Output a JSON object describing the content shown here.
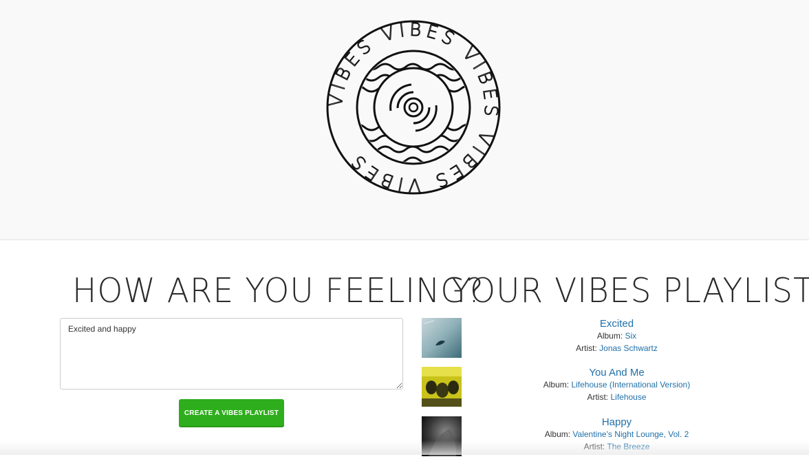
{
  "logo": {
    "ring_text": "VIBES VIBES VIBES VIBES VIBES",
    "icon": "vinyl-record-waves-icon"
  },
  "feeling": {
    "heading": "HOW ARE YOU FEELING?",
    "input_value": "Excited and happy",
    "button_label": "CREATE A VIBES PLAYLIST",
    "button_color": "#2eae1c"
  },
  "playlist": {
    "heading": "YOUR VIBES PLAYLIST",
    "album_label": "Album:",
    "artist_label": "Artist:",
    "link_color": "#1f6fa8",
    "tracks": [
      {
        "title": "Excited",
        "album": "Six",
        "artist": "Jonas Schwartz"
      },
      {
        "title": "You And Me",
        "album": "Lifehouse (International Version)",
        "artist": "Lifehouse"
      },
      {
        "title": "Happy",
        "album": "Valentine's Night Lounge, Vol. 2",
        "artist": "The Breeze"
      }
    ]
  }
}
